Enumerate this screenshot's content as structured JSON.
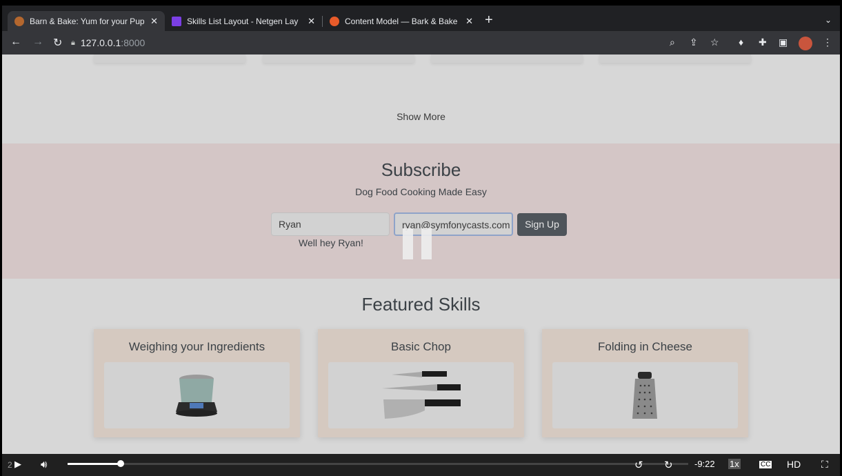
{
  "browser": {
    "tabs": [
      {
        "title": "Barn & Bake: Yum for your Pup",
        "favicon_color": "#b4672e",
        "active": true
      },
      {
        "title": "Skills List Layout - Netgen Lay",
        "favicon_color": "#7b3fe4",
        "active": false
      },
      {
        "title": "Content Model — Bark & Bake",
        "favicon_color": "#e85b2a",
        "active": false
      }
    ],
    "new_tab": "+",
    "tab_list": "⌄",
    "address": {
      "host": "127.0.0.1",
      "port": ":8000"
    }
  },
  "page": {
    "show_more": "Show More",
    "subscribe": {
      "title": "Subscribe",
      "tagline": "Dog Food Cooking Made Easy",
      "name_value": "Ryan",
      "email_value": "ryan@symfonycasts.com",
      "button": "Sign Up",
      "greeting": "Well hey Ryan!"
    },
    "featured": {
      "title": "Featured Skills",
      "skills": [
        {
          "name": "Weighing your Ingredients",
          "icon": "scale-icon"
        },
        {
          "name": "Basic Chop",
          "icon": "knives-icon"
        },
        {
          "name": "Folding in Cheese",
          "icon": "grater-icon"
        }
      ]
    }
  },
  "player": {
    "speed_label": "2",
    "progress": 0.085,
    "time_remaining": "-9:22",
    "playback_rate": "1x",
    "quality": "HD",
    "rewind_seconds": "10",
    "forward_seconds": "10"
  },
  "colors": {
    "subscribe_bg": "#d4c6c6",
    "skill_card_bg": "#d5c9c0",
    "signup_bg": "#4e545a"
  }
}
